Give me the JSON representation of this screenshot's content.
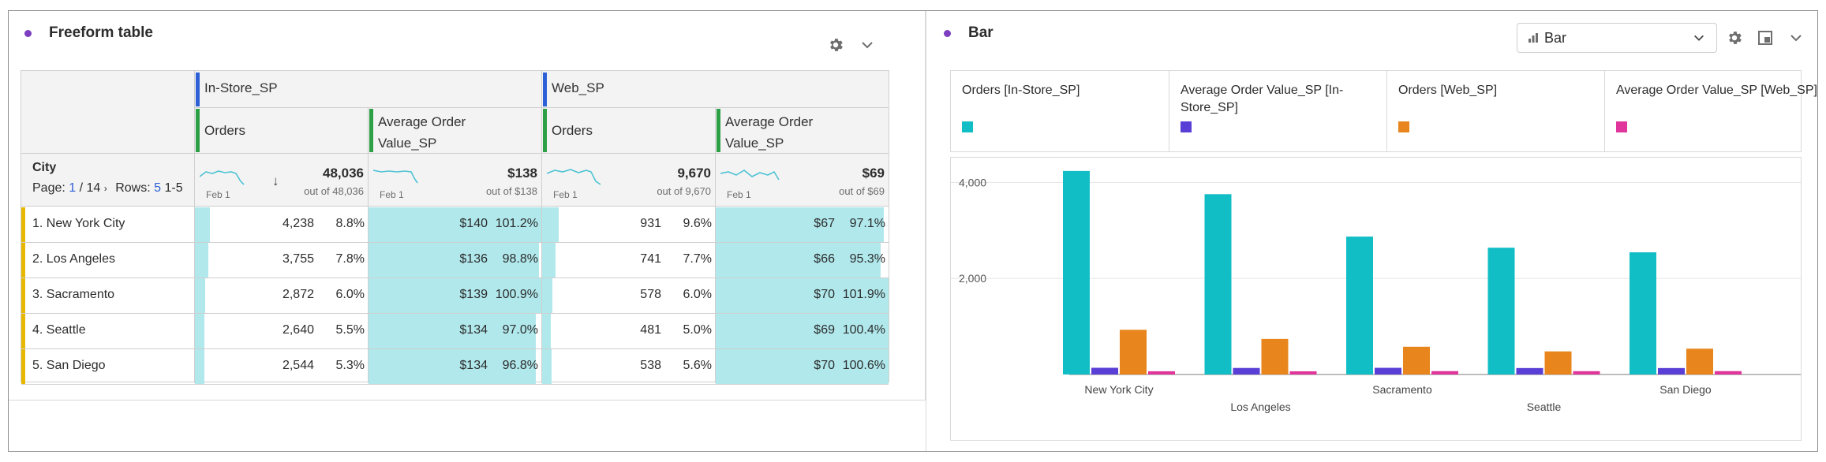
{
  "left_panel": {
    "title": "Freeform table",
    "table": {
      "dim_label": "City",
      "page_label": "Page:",
      "page_current": "1",
      "page_total": "/ 14",
      "rows_label": "Rows:",
      "rows_value": "5",
      "range_label": "1-5",
      "segments": [
        "In-Store_SP",
        "Web_SP"
      ],
      "metric_orders": "Orders",
      "metric_aov_line1": "Average Order",
      "metric_aov_line2": "Value_SP",
      "spark_label": "Feb 1",
      "sort_icon": "↓",
      "totals": [
        {
          "value": "48,036",
          "outof": "out of 48,036"
        },
        {
          "value": "$138",
          "outof": "out of $138"
        },
        {
          "value": "9,670",
          "outof": "out of 9,670"
        },
        {
          "value": "$69",
          "outof": "out of $69"
        }
      ],
      "rows": [
        {
          "name": "1.  New York City",
          "c1": "4,238",
          "p1": "8.8%",
          "c2": "$140",
          "p2": "101.2%",
          "c3": "931",
          "p3": "9.6%",
          "c4": "$67",
          "p4": "97.1%",
          "f1": 0.088,
          "f2": 1.012,
          "f3": 0.096,
          "f4": 0.971
        },
        {
          "name": "2.  Los Angeles",
          "c1": "3,755",
          "p1": "7.8%",
          "c2": "$136",
          "p2": "98.8%",
          "c3": "741",
          "p3": "7.7%",
          "c4": "$66",
          "p4": "95.3%",
          "f1": 0.078,
          "f2": 0.988,
          "f3": 0.077,
          "f4": 0.953
        },
        {
          "name": "3.  Sacramento",
          "c1": "2,872",
          "p1": "6.0%",
          "c2": "$139",
          "p2": "100.9%",
          "c3": "578",
          "p3": "6.0%",
          "c4": "$70",
          "p4": "101.9%",
          "f1": 0.06,
          "f2": 1.009,
          "f3": 0.06,
          "f4": 1.019
        },
        {
          "name": "4.  Seattle",
          "c1": "2,640",
          "p1": "5.5%",
          "c2": "$134",
          "p2": "97.0%",
          "c3": "481",
          "p3": "5.0%",
          "c4": "$69",
          "p4": "100.4%",
          "f1": 0.055,
          "f2": 0.97,
          "f3": 0.05,
          "f4": 1.004
        },
        {
          "name": "5.  San Diego",
          "c1": "2,544",
          "p1": "5.3%",
          "c2": "$134",
          "p2": "96.8%",
          "c3": "538",
          "p3": "5.6%",
          "c4": "$70",
          "p4": "100.6%",
          "f1": 0.053,
          "f2": 0.968,
          "f3": 0.056,
          "f4": 1.006
        }
      ]
    },
    "icons": [
      "gear-icon",
      "chevron-down-icon"
    ]
  },
  "right_panel": {
    "title": "Bar",
    "viz_dropdown": "Bar",
    "icons": [
      "bar-chart-icon",
      "chevron-down-icon",
      "gear-icon",
      "save-icon",
      "chevron-down-icon"
    ],
    "legend": [
      {
        "label": "Orders [In-Store_SP]",
        "color": "#12bec6"
      },
      {
        "label": "Average Order Value_SP [In-Store_SP]",
        "color": "#5a3fd6"
      },
      {
        "label": "Orders [Web_SP]",
        "color": "#e8861d"
      },
      {
        "label": "Average Order Value_SP [Web_SP]",
        "color": "#e0359a"
      }
    ]
  },
  "chart_data": {
    "type": "bar",
    "categories": [
      "New York City",
      "Los Angeles",
      "Sacramento",
      "Seattle",
      "San Diego"
    ],
    "series": [
      {
        "name": "Orders [In-Store_SP]",
        "values": [
          4238,
          3755,
          2872,
          2640,
          2544
        ],
        "color": "#12bec6"
      },
      {
        "name": "Average Order Value_SP [In-Store_SP]",
        "values": [
          140,
          136,
          139,
          134,
          134
        ],
        "color": "#5a3fd6"
      },
      {
        "name": "Orders [Web_SP]",
        "values": [
          931,
          741,
          578,
          481,
          538
        ],
        "color": "#e8861d"
      },
      {
        "name": "Average Order Value_SP [Web_SP]",
        "values": [
          67,
          66,
          70,
          69,
          70
        ],
        "color": "#e0359a"
      }
    ],
    "yticks": [
      "4,000",
      "2,000"
    ],
    "ytick_values": [
      4000,
      2000
    ],
    "ylim": [
      0,
      4400
    ],
    "grid": true,
    "legend_position": "top"
  }
}
